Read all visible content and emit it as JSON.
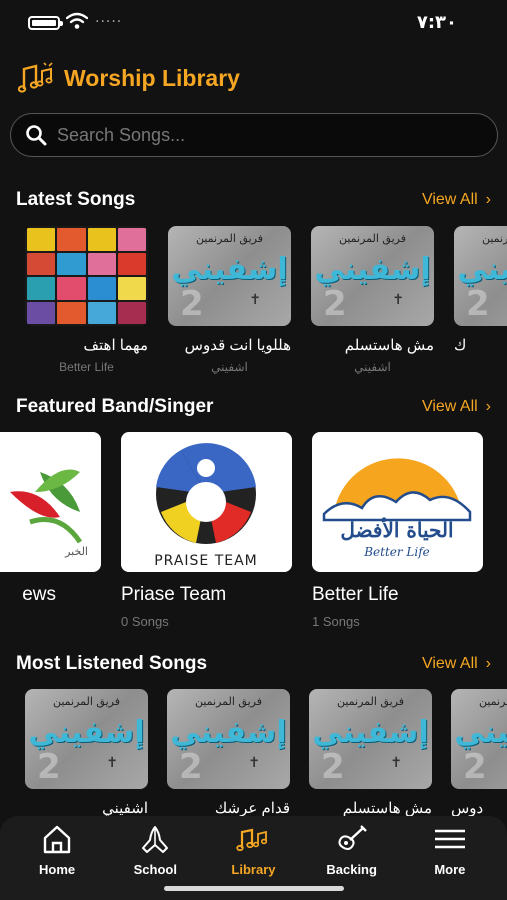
{
  "status_bar": {
    "time": "٧:٣٠",
    "carrier": "....."
  },
  "app": {
    "title": "Worship Library",
    "accent": "#f5a623",
    "logo_icon": "music-notes-icon"
  },
  "search": {
    "placeholder": "Search Songs..."
  },
  "latest": {
    "title": "Latest Songs",
    "view_all": "View All",
    "songs": [
      {
        "title": "مهما اهتف",
        "subtitle": "Better Life"
      },
      {
        "title": "هللويا انت قدوس",
        "subtitle": "اشفيني"
      },
      {
        "title": "مش هاستسلم",
        "subtitle": "اشفيني"
      },
      {
        "title": "ك",
        "subtitle": ""
      }
    ]
  },
  "featured": {
    "title": "Featured Band/Singer",
    "view_all": "View All",
    "bands": [
      {
        "name": "ews",
        "count": ""
      },
      {
        "name": "Priase Team",
        "count": "0 Songs",
        "logo_text": "PRAISE TEAM"
      },
      {
        "name": "Better Life",
        "count": "1 Songs",
        "logo_text": "Better Life"
      }
    ]
  },
  "most_listened": {
    "title": "Most Listened Songs",
    "view_all": "View All",
    "songs": [
      {
        "title": "اشفيني"
      },
      {
        "title": "قدام عرشك"
      },
      {
        "title": "مش هاستسلم"
      },
      {
        "title": "دوس"
      }
    ]
  },
  "album_art": {
    "top": "فريق المرنمين",
    "big": "إشفيني",
    "num": "2"
  },
  "nav": {
    "items": [
      {
        "label": "Home",
        "icon": "home-icon"
      },
      {
        "label": "School",
        "icon": "praying-hands-icon"
      },
      {
        "label": "Library",
        "icon": "music-notes-icon",
        "active": true
      },
      {
        "label": "Backing",
        "icon": "guitar-icon"
      },
      {
        "label": "More",
        "icon": "menu-icon"
      }
    ]
  }
}
